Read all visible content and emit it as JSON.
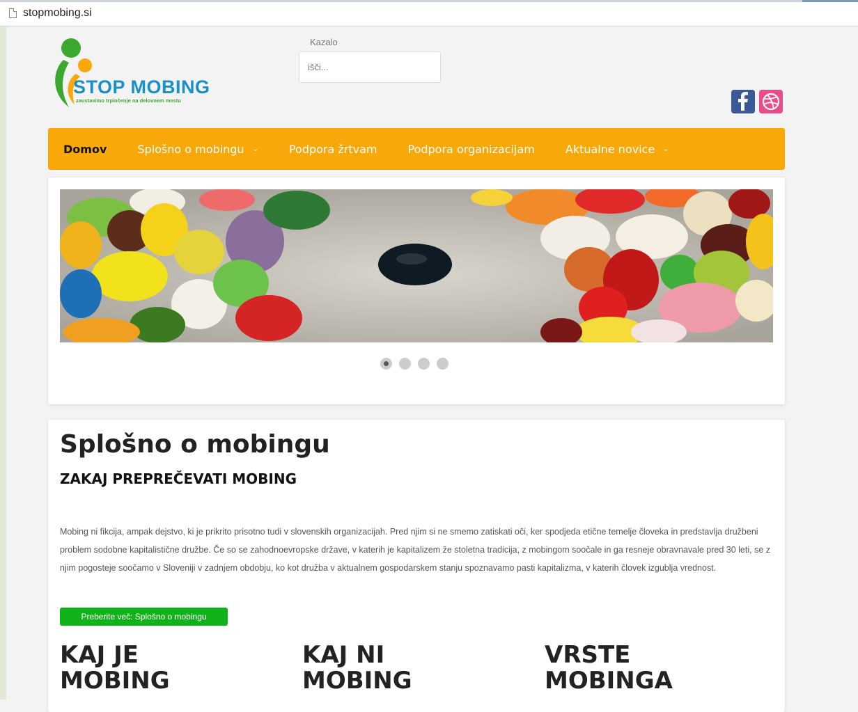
{
  "browser": {
    "url": "stopmobing.si"
  },
  "logo": {
    "title": "STOP MOBING",
    "tagline": "zaustavimo trpinčenje na delovnem mestu"
  },
  "search": {
    "label": "Kazalo",
    "placeholder": "išči..."
  },
  "social": {
    "facebook_icon": "facebook-icon",
    "dribbble_icon": "dribbble-icon"
  },
  "nav": {
    "items": [
      {
        "label": "Domov",
        "active": true
      },
      {
        "label": "Splošno o mobingu",
        "dropdown": true
      },
      {
        "label": "Podpora žrtvam"
      },
      {
        "label": "Podpora organizacijam"
      },
      {
        "label": "Aktualne novice",
        "dropdown": true
      }
    ]
  },
  "slider": {
    "slide_count": 4,
    "active_slide": 1
  },
  "content": {
    "title": "Splošno o mobingu",
    "subtitle": "ZAKAJ PREPREČEVATI MOBING",
    "intro": "Mobing ni fikcija, ampak dejstvo, ki je prikrito prisotno tudi v slovenskih organizacijah. Pred njim si ne smemo zatiskati oči, ker spodjeda etične temelje človeka in predstavlja družbeni problem sodobne kapitalistične družbe. Če so se zahodnoevropske države, v katerih je kapitalizem že stoletna tradicija, z mobingom soočale in ga resneje obravnavale pred 30 leti, se z njim pogosteje soočamo v Sloveniji v zadnjem obdobju, ko kot družba v aktualnem gospodarskem stanju spoznavamo pasti kapitalizma, v katerih človek izgublja vrednost.",
    "readmore": "Preberite več: Splošno o mobingu",
    "columns": [
      {
        "title": "KAJ JE MOBING"
      },
      {
        "title": "KAJ NI MOBING"
      },
      {
        "title": "VRSTE MOBINGA"
      }
    ]
  }
}
